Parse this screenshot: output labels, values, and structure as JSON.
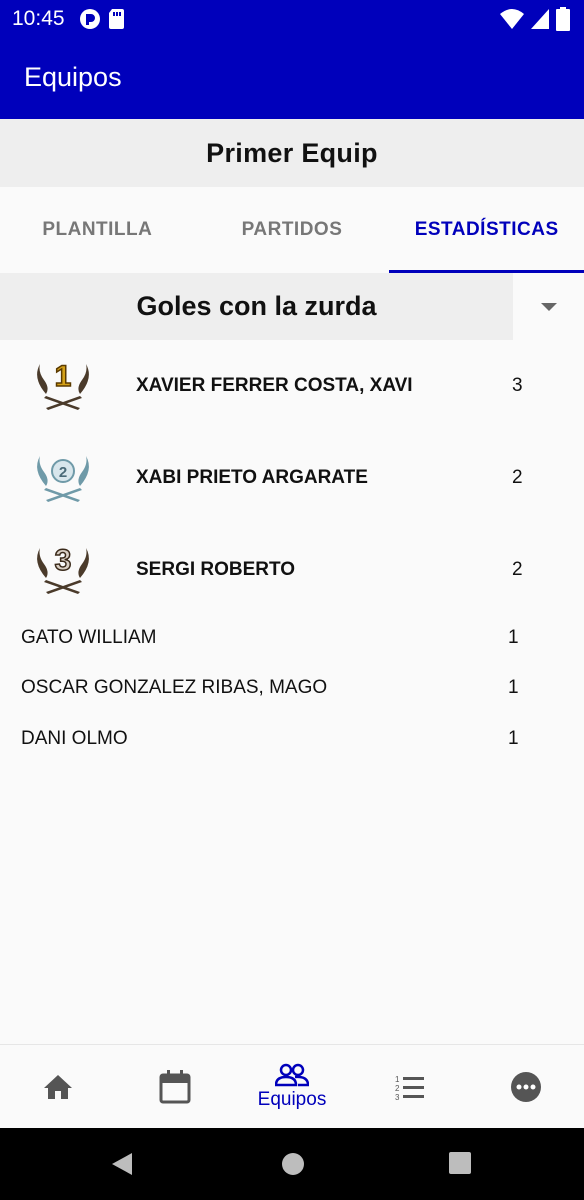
{
  "status_bar": {
    "time": "10:45"
  },
  "app_bar": {
    "title": "Equipos"
  },
  "team": {
    "name": "Primer Equip"
  },
  "tabs": [
    {
      "label": "PLANTILLA",
      "active": false
    },
    {
      "label": "PARTIDOS",
      "active": false
    },
    {
      "label": "ESTADÍSTICAS",
      "active": true
    }
  ],
  "stat_selector": {
    "selected": "Goles con la zurda"
  },
  "podium": [
    {
      "rank": 1,
      "rank_label": "1",
      "name": "XAVIER FERRER COSTA, XAVI",
      "value": "3",
      "medal_color": "#d4a017"
    },
    {
      "rank": 2,
      "rank_label": "2",
      "name": "XABI PRIETO ARGARATE",
      "value": "2",
      "medal_color": "#8fb2c0"
    },
    {
      "rank": 3,
      "rank_label": "3",
      "name": "SERGI ROBERTO",
      "value": "2",
      "medal_color": "#5a4a3a"
    }
  ],
  "others": [
    {
      "name": "GATO WILLIAM",
      "value": "1"
    },
    {
      "name": "OSCAR GONZALEZ RIBAS, MAGO",
      "value": "1"
    },
    {
      "name": "DANI OLMO",
      "value": "1"
    }
  ],
  "bottom_nav": [
    {
      "icon": "home-icon",
      "label": "",
      "active": false
    },
    {
      "icon": "calendar-icon",
      "label": "",
      "active": false
    },
    {
      "icon": "team-icon",
      "label": "Equipos",
      "active": true
    },
    {
      "icon": "ranking-list-icon",
      "label": "",
      "active": false
    },
    {
      "icon": "more-icon",
      "label": "",
      "active": false
    }
  ],
  "colors": {
    "primary": "#0000bb",
    "header_gray": "#eeeeee",
    "background": "#fafafa"
  }
}
